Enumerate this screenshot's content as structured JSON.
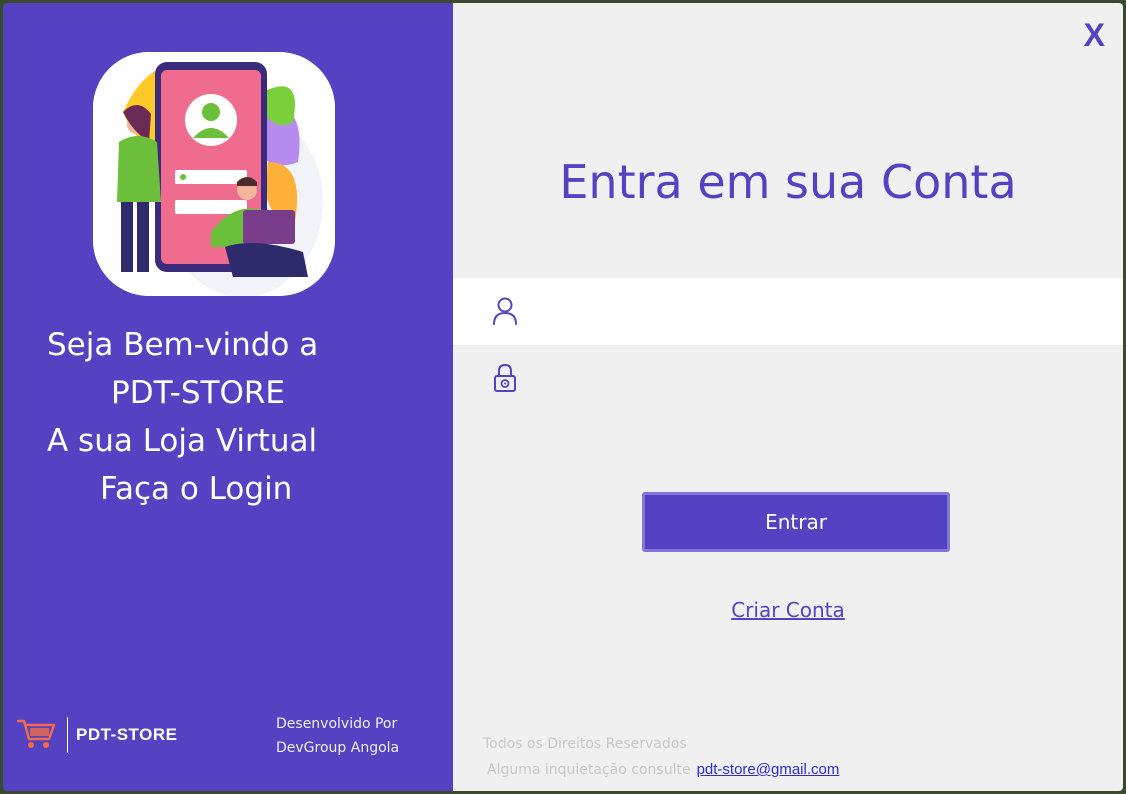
{
  "welcome": {
    "line1": "Seja Bem-vindo a",
    "line2": "PDT-STORE",
    "line3": "A sua Loja Virtual",
    "line4": "Faça o Login"
  },
  "brand": {
    "name": "PDT-STORE",
    "logo_icon": "shopping-cart-icon"
  },
  "developer": {
    "line1": "Desenvolvido Por",
    "line2": "DevGroup Angola"
  },
  "window": {
    "close_label": "X"
  },
  "login": {
    "title": "Entra em sua Conta",
    "username_value": "",
    "password_value": "",
    "user_icon": "user-icon",
    "password_icon": "lock-icon",
    "submit_label": "Entrar",
    "create_account_label": "Criar Conta"
  },
  "footer": {
    "rights": "Todos os Direitos Reservados",
    "inquiry_text": "Alguma inquietação consulte",
    "email": "pdt-store@gmail.com"
  },
  "colors": {
    "accent": "#5442c3",
    "panel_bg": "#f0f0f0",
    "link": "#2b2bd9"
  }
}
